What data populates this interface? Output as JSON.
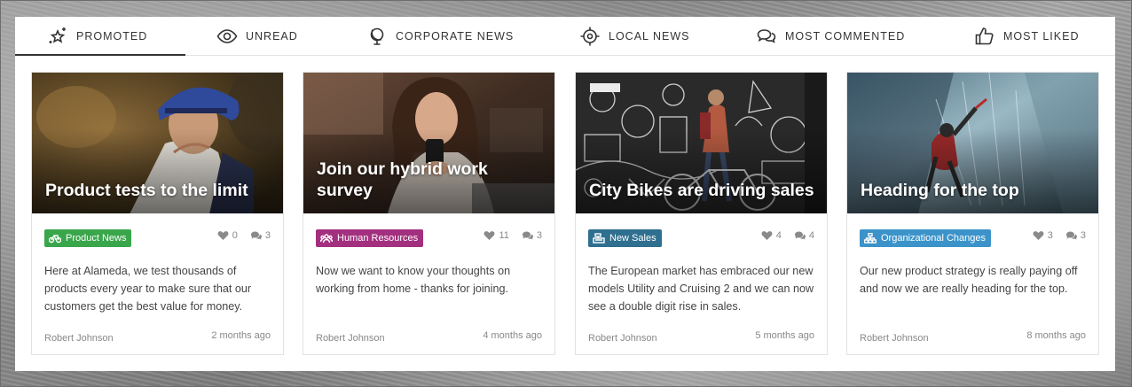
{
  "tabs": [
    {
      "label": "PROMOTED",
      "icon": "sparkle-star-icon",
      "active": true
    },
    {
      "label": "UNREAD",
      "icon": "eye-icon",
      "active": false
    },
    {
      "label": "CORPORATE NEWS",
      "icon": "globe-icon",
      "active": false
    },
    {
      "label": "LOCAL NEWS",
      "icon": "crosshair-icon",
      "active": false
    },
    {
      "label": "MOST COMMENTED",
      "icon": "chat-bubbles-icon",
      "active": false
    },
    {
      "label": "MOST LIKED",
      "icon": "thumbs-up-icon",
      "active": false
    }
  ],
  "cards": [
    {
      "title": "Product tests to the limit",
      "tag": "Product News",
      "tag_color": "#3aa64b",
      "tag_icon": "bicycle-icon",
      "likes": "0",
      "comments": "3",
      "excerpt": "Here at Alameda, we test thousands of products every year to make sure that our customers get the best value for money.",
      "author": "Robert Johnson",
      "time": "2 months ago"
    },
    {
      "title": "Join our hybrid work survey",
      "tag": "Human Resources",
      "tag_color": "#a3307e",
      "tag_icon": "people-icon",
      "likes": "11",
      "comments": "3",
      "excerpt": "Now we want to know your thoughts on working from home - thanks for joining.",
      "author": "Robert Johnson",
      "time": "4 months ago"
    },
    {
      "title": "City Bikes are driving sales",
      "tag": "New Sales",
      "tag_color": "#2f6f8f",
      "tag_icon": "cash-register-icon",
      "likes": "4",
      "comments": "4",
      "excerpt": "The European market has embraced our new models Utility and Cruising 2 and we can now see a double digit rise in sales.",
      "author": "Robert Johnson",
      "time": "5 months ago"
    },
    {
      "title": "Heading for the top",
      "tag": "Organizational Changes",
      "tag_color": "#3b93c9",
      "tag_icon": "org-chart-icon",
      "likes": "3",
      "comments": "3",
      "excerpt": "Our new product strategy is really paying off and now we are really heading for the top.",
      "author": "Robert Johnson",
      "time": "8 months ago"
    }
  ]
}
